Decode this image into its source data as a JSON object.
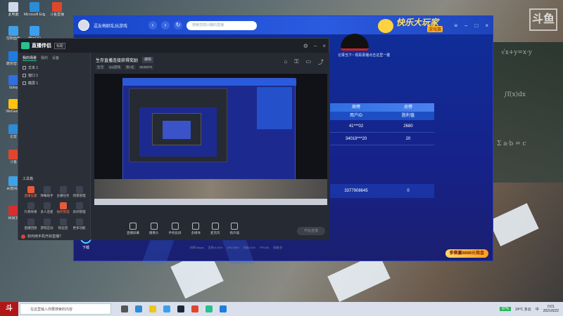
{
  "desktop": {
    "icons": [
      {
        "label": "此电脑",
        "color": "#cfd8e8"
      },
      {
        "label": "Microsoft Edge",
        "color": "#2e8bd6"
      },
      {
        "label": "斗鱼直播",
        "color": "#e0462e"
      },
      {
        "label": "控制面板",
        "color": "#3fa2e8"
      },
      {
        "label": "腾讯QQ",
        "color": "#39a0f0"
      },
      {
        "label": "酷狗音乐",
        "color": "#1e7de0"
      },
      {
        "label": "EPIC Games",
        "color": "#222222"
      },
      {
        "label": "Uplay",
        "color": "#2f6fe0"
      },
      {
        "label": "Steam",
        "color": "#1b2838"
      },
      {
        "label": "WeGame",
        "color": "#ffc20e"
      },
      {
        "label": "鲁大师",
        "color": "#e85a3a"
      },
      {
        "label": "迅雷",
        "color": "#2e8bd6"
      },
      {
        "label": "QQ音乐",
        "color": "#f0c419"
      },
      {
        "label": "斗鱼",
        "color": "#e0462e"
      },
      {
        "label": "微信",
        "color": "#2bb45a"
      },
      {
        "label": "百度网盘",
        "color": "#3fa2e8"
      },
      {
        "label": "网易云",
        "color": "#d82e2e"
      },
      {
        "label": "爱奇艺",
        "color": "#2bb45a"
      }
    ]
  },
  "browser": {
    "room_name": "逗友梅龄乱玩游戏",
    "search_placeholder": "搜索您感兴趣的直播",
    "banner_title": "快乐大玩家",
    "banner_badge": "游戏赛",
    "share_text": "记录当下~ 观看录播点击这里一键",
    "rank": {
      "headers": [
        "",
        "用户ID",
        "胜利值"
      ],
      "section_headers": [
        "周榜",
        "总榜"
      ],
      "rows": [
        {
          "user": "41***02",
          "score": "2680"
        },
        {
          "user": "34019***20",
          "score": "20"
        }
      ],
      "extra_row": {
        "user": "3377908645",
        "score": "0"
      }
    },
    "promo": "参赛赢8888元现金",
    "bottom_tool": "下载"
  },
  "app": {
    "logo": "直播伴侣",
    "version_tag": "标配",
    "tabs": [
      "我的场景",
      "我的",
      "设备"
    ],
    "scenes": [
      "文本 1",
      "窗口 1",
      "截屏 1"
    ],
    "toolbox_title": "工具箱",
    "tools": [
      {
        "label": "直播设置",
        "red": true
      },
      {
        "label": "弹幕助手",
        "red": false
      },
      {
        "label": "主播任务",
        "red": false
      },
      {
        "label": "场景管理",
        "red": false
      },
      {
        "label": "礼物效果",
        "red": false
      },
      {
        "label": "多人连麦",
        "red": false
      },
      {
        "label": "抽奖管理",
        "red": true
      },
      {
        "label": "房间管理",
        "red": false
      },
      {
        "label": "直播回放",
        "red": false
      },
      {
        "label": "游戏互动",
        "red": false
      },
      {
        "label": "粉丝团",
        "red": false
      },
      {
        "label": "更多功能",
        "red": false
      }
    ],
    "hint": "如何用手机开启直播?",
    "stage": {
      "title": "生存直播连接获得奖励",
      "title_tag": "编辑",
      "meta": [
        "生活",
        "QQ游戏",
        "第1名",
        "5538879"
      ],
      "controls": [
        "直播屏幕",
        "摄像头",
        "手机投屏",
        "多媒体",
        "麦克风",
        "扬声器"
      ],
      "go_live": "开始直播",
      "stats": [
        "码率:0kbps",
        "丢帧:0.00%",
        "CPU:30%",
        "内存:41%",
        "FPS:60",
        "网络:好"
      ]
    }
  },
  "taskbar": {
    "search_placeholder": "在这里输入你要搜索的内容",
    "battery": "87%",
    "weather": "24°C 多云",
    "lang": "中",
    "time": "0:01",
    "date": "2021/6/22"
  }
}
